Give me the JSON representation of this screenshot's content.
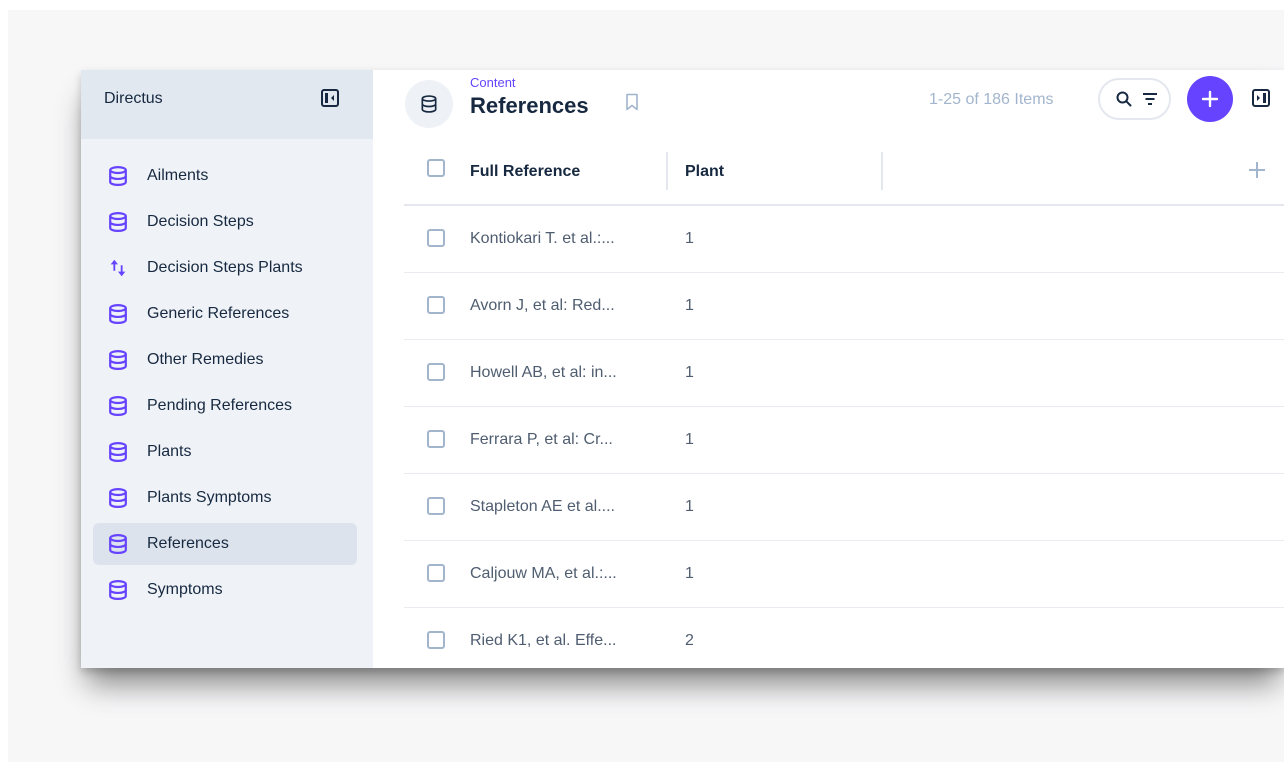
{
  "sidebar": {
    "project_name": "Directus",
    "items": [
      {
        "label": "Ailments",
        "icon": "database-icon",
        "active": false
      },
      {
        "label": "Decision Steps",
        "icon": "database-icon",
        "active": false
      },
      {
        "label": "Decision Steps Plants",
        "icon": "import-export-icon",
        "active": false
      },
      {
        "label": "Generic References",
        "icon": "database-icon",
        "active": false
      },
      {
        "label": "Other Remedies",
        "icon": "database-icon",
        "active": false
      },
      {
        "label": "Pending References",
        "icon": "database-icon",
        "active": false
      },
      {
        "label": "Plants",
        "icon": "database-icon",
        "active": false
      },
      {
        "label": "Plants Symptoms",
        "icon": "database-icon",
        "active": false
      },
      {
        "label": "References",
        "icon": "database-icon",
        "active": true
      },
      {
        "label": "Symptoms",
        "icon": "database-icon",
        "active": false
      }
    ]
  },
  "header": {
    "breadcrumb": "Content",
    "title": "References",
    "item_count": "1-25 of 186 Items"
  },
  "table": {
    "columns": [
      "Full Reference",
      "Plant"
    ],
    "rows": [
      {
        "reference": "Kontiokari T. et al.:...",
        "plant": "1"
      },
      {
        "reference": "Avorn J, et al: Red...",
        "plant": "1"
      },
      {
        "reference": "Howell AB, et al: in...",
        "plant": "1"
      },
      {
        "reference": "Ferrara P, et al: Cr...",
        "plant": "1"
      },
      {
        "reference": "Stapleton AE et al....",
        "plant": "1"
      },
      {
        "reference": "Caljouw MA, et al.:...",
        "plant": "1"
      },
      {
        "reference": "Ried K1, et al. Effe...",
        "plant": "2"
      }
    ]
  },
  "colors": {
    "accent": "#6644ff",
    "sidebar_bg": "#eff2f7",
    "sidebar_header_bg": "#e2e8f0",
    "active_item_bg": "#dde3ec",
    "muted_text": "#a2b5cd"
  }
}
